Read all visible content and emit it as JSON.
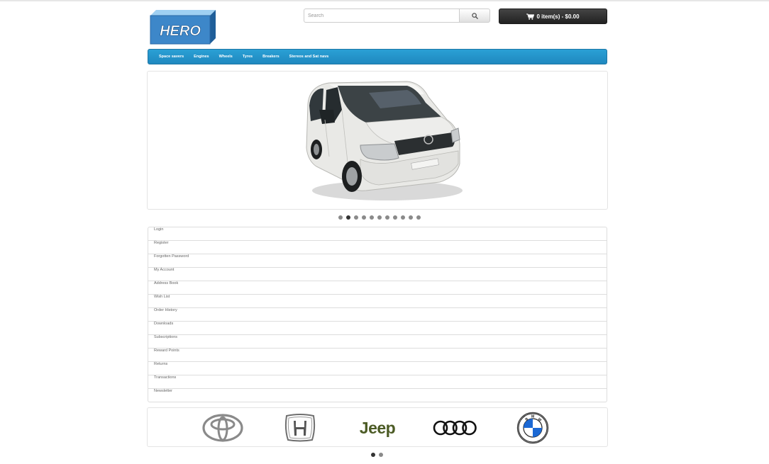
{
  "store": {
    "logo_text": "HERO"
  },
  "search": {
    "placeholder": "Search",
    "icon": "search-icon"
  },
  "cart": {
    "label": "0 item(s) - $0.00",
    "icon": "cart-icon"
  },
  "nav": {
    "items": [
      "Space savers",
      "Engines",
      "Wheels",
      "Tyres",
      "Breakers",
      "Stereos and Sat navs"
    ]
  },
  "slideshow": {
    "image": "white-van-photo",
    "dot_count": 11,
    "active_index": 1
  },
  "account_menu": {
    "items": [
      "Login",
      "Register",
      "Forgotten Password",
      "My Account",
      "Address Book",
      "Wish List",
      "Order History",
      "Downloads",
      "Subscriptions",
      "Reward Points",
      "Returns",
      "Transactions",
      "Newsletter"
    ]
  },
  "brands": {
    "items": [
      "toyota-logo",
      "honda-logo",
      "jeep-logo",
      "audi-logo",
      "bmw-logo"
    ],
    "jeep_text": "Jeep",
    "bmw_letters": [
      "B",
      "M",
      "W"
    ],
    "dot_count": 2,
    "active_index": 0
  },
  "colors": {
    "nav_blue": "#2aa0d5",
    "cart_dark": "#333333",
    "jeep_green": "#4c5b25",
    "bmw_blue": "#1c69d4"
  }
}
